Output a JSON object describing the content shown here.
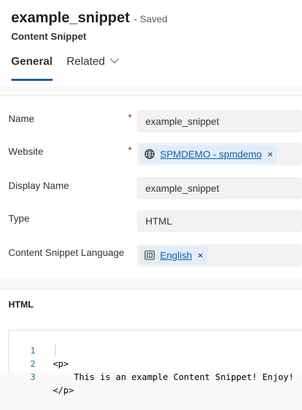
{
  "header": {
    "title": "example_snippet",
    "status": "- Saved",
    "entity": "Content Snippet",
    "tabs": [
      {
        "label": "General",
        "active": true
      },
      {
        "label": "Related",
        "has_chevron": true
      }
    ]
  },
  "form": {
    "name": {
      "label": "Name",
      "required_marker": "*",
      "value": "example_snippet"
    },
    "website": {
      "label": "Website",
      "required_marker": "*",
      "value": "SPMDEMO - spmdemo",
      "icon": "globe-icon",
      "remove": "×"
    },
    "display_name": {
      "label": "Display Name",
      "value": "example_snippet"
    },
    "type": {
      "label": "Type",
      "value": "HTML"
    },
    "language": {
      "label": "Content Snippet Language",
      "value": "English",
      "icon": "language-icon",
      "remove": "×"
    }
  },
  "html_section": {
    "title": "HTML",
    "lines": [
      {
        "number": "1",
        "text": "<p>"
      },
      {
        "number": "2",
        "text": "    This is an example Content Snippet! Enjoy!"
      },
      {
        "number": "3",
        "text": "</p>"
      }
    ]
  },
  "colors": {
    "accent": "#115ea3",
    "required": "#a4262c",
    "tag_bg": "#e1eefa",
    "field_bg": "#f3f2f1",
    "line_number": "#237893"
  }
}
